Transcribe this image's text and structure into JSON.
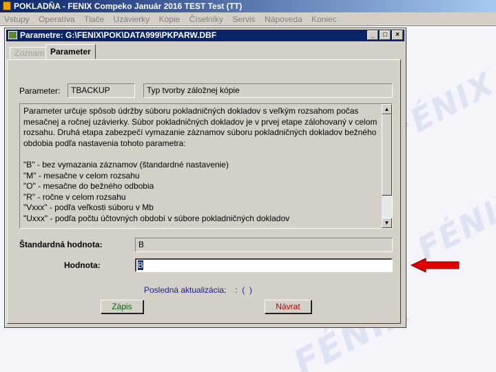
{
  "app": {
    "title": "POKLADŇA - FENIX Compeko   Január 2016   TEST Test  (TT)",
    "menu": [
      "Vstupy",
      "Operatíva",
      "Tlače",
      "Uzávierky",
      "Kópie",
      "Číselníky",
      "Servis",
      "Nápoveda",
      "Koniec"
    ]
  },
  "watermark": "FÉNIX",
  "window": {
    "title": "Parametre: G:\\FENIX\\POK\\DATA999\\PKPARW.DBF",
    "controls": [
      "_",
      "□",
      "×"
    ]
  },
  "tabs": [
    {
      "label": "Zoznam",
      "active": false
    },
    {
      "label": "Parameter",
      "active": true
    }
  ],
  "form": {
    "parameter_label": "Parameter:",
    "parameter_code": "TBACKUP",
    "parameter_name": "Typ tvorby záložnej kópie",
    "description": [
      "Parameter určuje spôsob údržby súboru pokladničných dokladov s veľkým rozsahom počas",
      "mesačnej a ročnej uzávierky. Súbor pokladničných dokladov je v prvej etape zálohovaný v celom",
      "rozsahu. Druhá etapa zabezpečí vymazanie záznamov súboru pokladničných dokladov bežného",
      "obdobia podľa nastavenia tohoto parametra:",
      "",
      "\"B\"     - bez vymazania záznamov  (štandardné nastavenie)",
      "\"M\"     - mesačne v celom rozsahu",
      "\"O\"     - mesačne do bežného odbobia",
      "\"R\"     - ročne v celom rozsahu",
      "\"Vxxx\" - podľa veľkosti súboru v Mb",
      "\"Uxxx\" - podľa počtu účtovných období v súbore pokladničných dokladov"
    ],
    "default_label": "Štandardná hodnota:",
    "default_value": "B",
    "value_label": "Hodnota:",
    "value": "B",
    "last_update_label": "Posledná aktualizácia:",
    "last_update_value": ". .    :  (  )"
  },
  "buttons": {
    "save": "Zápis",
    "back": "Návrat"
  },
  "colors": {
    "title_bar": "#0a246a",
    "face": "#d4d0c8",
    "save_text": "#006400",
    "back_text": "#b00000",
    "link_text": "#1a1a8c",
    "arrow": "#e00000"
  }
}
